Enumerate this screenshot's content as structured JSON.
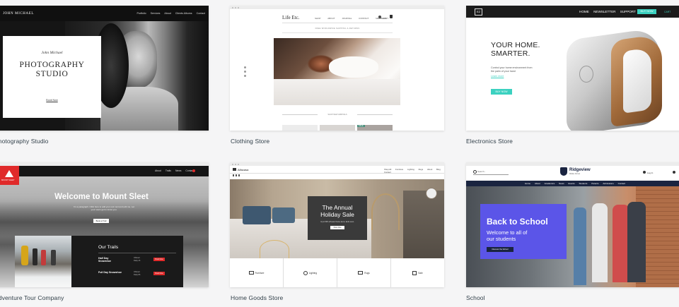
{
  "templates": [
    {
      "caption": "Photography Studio",
      "brand": "JOHN MICHAEL",
      "nav": [
        "Portfolio",
        "Services",
        "About",
        "Clients Albums",
        "Contact"
      ],
      "signature": "John Michael",
      "headline_line1": "PHOTOGRAPHY",
      "headline_line2": "STUDIO",
      "cta": "Book Now"
    },
    {
      "caption": "Clothing Store",
      "brand": "Life Etc.",
      "nav": [
        "SHOP",
        "ABOUT",
        "JOURNAL",
        "CONTACT",
        "MEMBERS"
      ],
      "cart_label": "CART",
      "banner_text": "FREE WORLDWIDE SHIPPING & RETURNS",
      "section_label": "SHOP NEW ARRIVALS",
      "sale_badge": "SALE"
    },
    {
      "caption": "Electronics Store",
      "logo": "EZ",
      "nav": [
        "HOME",
        "NEWSLETTER",
        "SUPPORT"
      ],
      "nav_cta": "BUY NOW",
      "cart_label": "CART",
      "headline_line1": "YOUR HOME.",
      "headline_line2": "SMARTER.",
      "subtext": "Control your home environment from the palm of your hand",
      "learn_more": "Learn more",
      "cta": "BUY NOW"
    },
    {
      "caption": "Adventure Tour Company",
      "logo_text": "MOUNT SLEET",
      "nav": [
        "About",
        "Trails",
        "News",
        "Contact"
      ],
      "headline": "Welcome to Mount Sleet",
      "subtext": "I'm a paragraph. Click here to add your own text and edit me. Let your users get to know you.",
      "cta": "Book a Trail",
      "trails_heading": "Our Trails",
      "trails": [
        {
          "name": "Half Day Snowshoe",
          "detail": "Offered Daily 4h",
          "button": "Book Now"
        },
        {
          "name": "Full Day Snowshoe",
          "detail": "Offered Daily 8h",
          "button": "Book Now"
        }
      ]
    },
    {
      "caption": "Home Goods Store",
      "brand": "Alfacasa",
      "nav": [
        "Shop All",
        "Furniture",
        "Lighting",
        "Rugs",
        "About",
        "Blog",
        "Contact"
      ],
      "sale_line1": "The Annual",
      "sale_line2": "Holiday Sale",
      "sale_subtext": "Up to 50% off select home items. Ends soon.",
      "sale_cta": "Shop Now",
      "categories": [
        "Furniture",
        "Lighting",
        "Rugs",
        "Sale"
      ]
    },
    {
      "caption": "School",
      "search_placeholder": "Search...",
      "login": "Log In",
      "school_name": "Ridgeview",
      "school_tagline": "Middle School",
      "nav": [
        "Home",
        "About",
        "Academics",
        "News",
        "Events",
        "Students",
        "Parents",
        "Admissions",
        "Contact"
      ],
      "headline": "Back to School",
      "subtext_line1": "Welcome to all of",
      "subtext_line2": "our students",
      "cta": "Discover the School"
    }
  ],
  "colors": {
    "page_bg": "#f5f5f6",
    "teal_accent": "#3bd1c0",
    "red_accent": "#e02a2a",
    "school_purple": "#5b55e8"
  }
}
